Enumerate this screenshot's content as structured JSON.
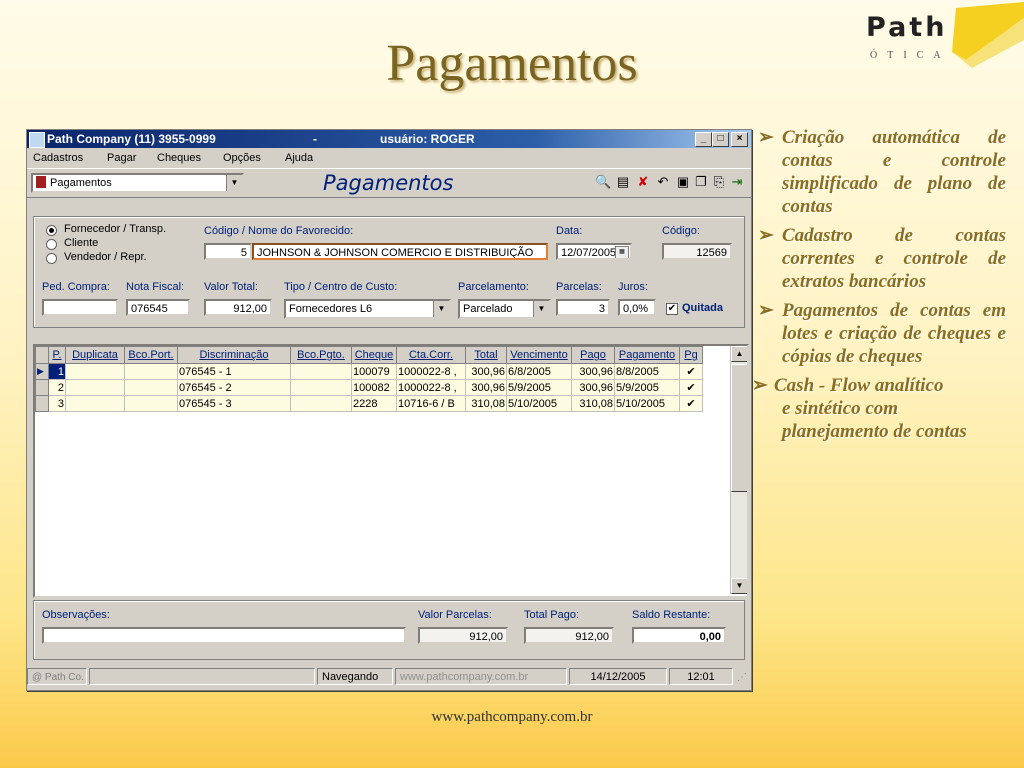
{
  "slide": {
    "title": "Pagamentos",
    "logo": {
      "name": "Path",
      "subtitle": "ÓTICA"
    },
    "footer_url": "www.pathcompany.com.br",
    "bullets": [
      "Criação automática de contas e controle simplificado de plano de contas",
      "Cadastro de contas correntes e controle de extratos bancários",
      "Pagamentos de contas em lotes e criação de cheques e cópias de cheques",
      "Cash - Flow analítico",
      "e sintético com planejamento de contas"
    ]
  },
  "window": {
    "title": "Path Company (11) 3955-0999",
    "title_sep": "-",
    "user": "usuário: ROGER",
    "controls": {
      "minimize": "_",
      "maximize": "□",
      "close": "×"
    },
    "menu": [
      "Cadastros",
      "Pagar",
      "Cheques",
      "Opções",
      "Ajuda"
    ],
    "module_select": "Pagamentos",
    "form_title": "Pagamentos",
    "toolbar_icons": [
      "preview-icon",
      "print-icon",
      "delete-icon",
      "undo-icon",
      "save-icon",
      "new-icon",
      "copy-icon",
      "exit-icon"
    ]
  },
  "form": {
    "favorecido_type": {
      "options": [
        "Fornecedor / Transp.",
        "Cliente",
        "Vendedor / Repr."
      ],
      "selected": 0
    },
    "codigo_nome_label": "Código   / Nome do Favorecido:",
    "codigo": "5",
    "nome": "JOHNSON & JOHNSON COMERCIO E DISTRIBUIÇÃO",
    "data_label": "Data:",
    "data": "12/07/2005",
    "codigo2_label": "Código:",
    "codigo2": "12569",
    "ped_compra_label": "Ped. Compra:",
    "ped_compra": "",
    "nota_fiscal_label": "Nota Fiscal:",
    "nota_fiscal": "076545",
    "valor_total_label": "Valor Total:",
    "valor_total": "912,00",
    "tipo_label": "Tipo / Centro de Custo:",
    "tipo": "Fornecedores L6",
    "parcelamento_label": "Parcelamento:",
    "parcelamento": "Parcelado",
    "parcelas_label": "Parcelas:",
    "parcelas": "3",
    "juros_label": "Juros:",
    "juros": "0,0%",
    "quitada_label": "Quitada",
    "quitada": true
  },
  "table": {
    "columns": [
      "P.",
      "Duplicata",
      "Bco.Port.",
      "Discriminação",
      "Bco.Pgto.",
      "Cheque",
      "Cta.Corr.",
      "Total",
      "Vencimento",
      "Pago",
      "Pagamento",
      "Pg"
    ],
    "rows": [
      [
        "1",
        "",
        "",
        "076545 - 1",
        "",
        "100079",
        "1000022-8 ,",
        "300,96",
        "6/8/2005",
        "300,96",
        "8/8/2005",
        "✔"
      ],
      [
        "2",
        "",
        "",
        "076545 - 2",
        "",
        "100082",
        "1000022-8 ,",
        "300,96",
        "5/9/2005",
        "300,96",
        "5/9/2005",
        "✔"
      ],
      [
        "3",
        "",
        "",
        "076545 - 3",
        "",
        "2228",
        "10716-6 / B",
        "310,08",
        "5/10/2005",
        "310,08",
        "5/10/2005",
        "✔"
      ]
    ]
  },
  "bottom": {
    "observacoes_label": "Observações:",
    "observacoes": "",
    "valor_parcelas_label": "Valor Parcelas:",
    "valor_parcelas": "912,00",
    "total_pago_label": "Total Pago:",
    "total_pago": "912,00",
    "saldo_label": "Saldo Restante:",
    "saldo": "0,00"
  },
  "status": {
    "copyright": "@ Path Co.",
    "mode": "Navegando",
    "url": "www.pathcompany.com.br",
    "date": "14/12/2005",
    "time": "12:01"
  }
}
